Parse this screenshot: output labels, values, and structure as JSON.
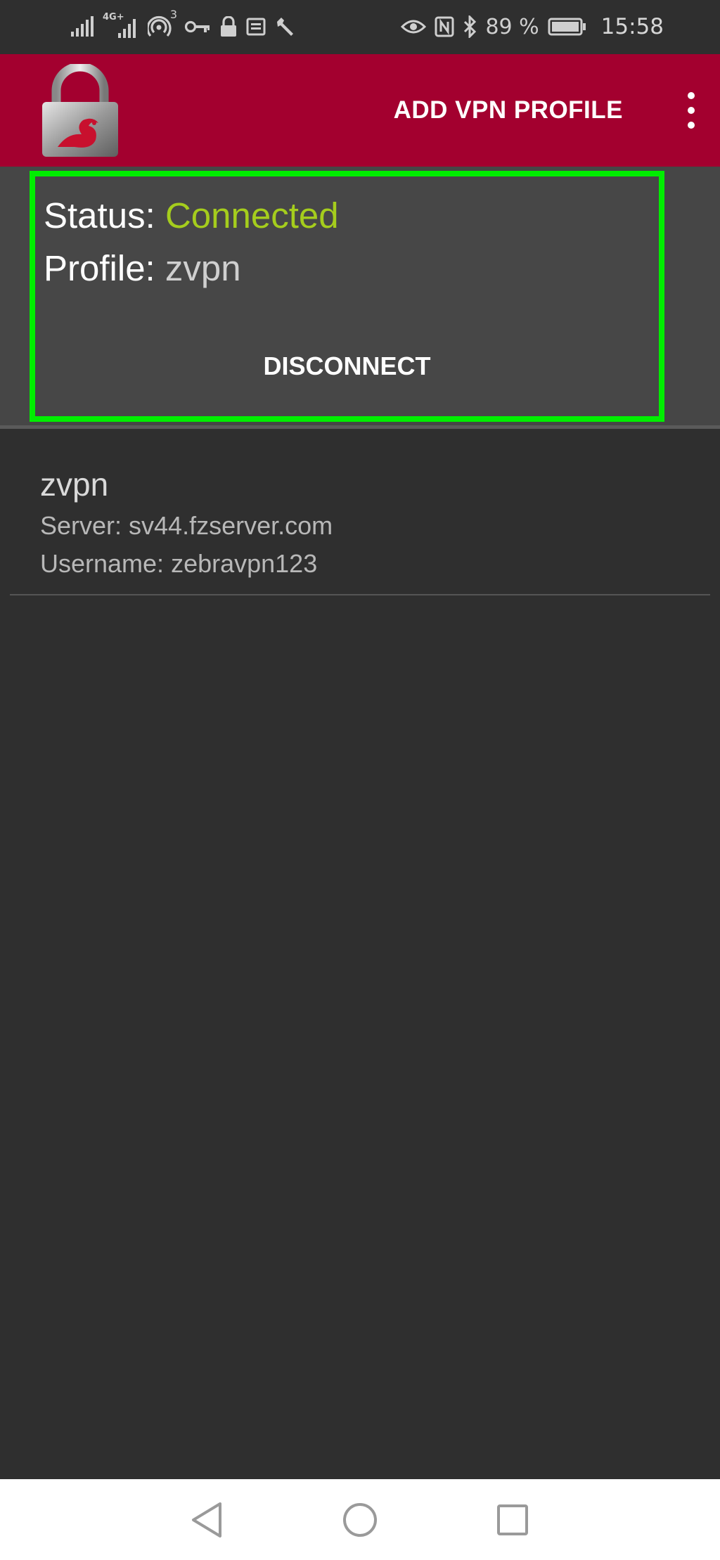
{
  "status_bar": {
    "signal_badge": "4G+",
    "hotspot_count": "3",
    "battery": "89 %",
    "time": "15:58",
    "icons": [
      "signal-icon",
      "signal-4g-icon",
      "hotspot-icon",
      "vpn-key-icon",
      "lock-icon",
      "notification-icon",
      "wrench-icon",
      "eye-icon",
      "nfc-icon",
      "bluetooth-icon",
      "battery-icon"
    ]
  },
  "app_bar": {
    "add_profile_label": "ADD VPN PROFILE",
    "logo_icon": "padlock-logo-icon",
    "menu_icon": "overflow-menu-icon",
    "color": "#a3002f"
  },
  "status_card": {
    "status_label": "Status:",
    "status_value": "Connected",
    "profile_label": "Profile:",
    "profile_value": "zvpn",
    "disconnect_label": "DISCONNECT",
    "highlight_color": "#00ee00",
    "status_color": "#a5cd1d"
  },
  "profiles": [
    {
      "name": "zvpn",
      "server": "Server: sv44.fzserver.com",
      "username": "Username: zebravpn123"
    }
  ],
  "nav_bar": {
    "icons": [
      "back-icon",
      "home-icon",
      "recents-icon"
    ]
  }
}
